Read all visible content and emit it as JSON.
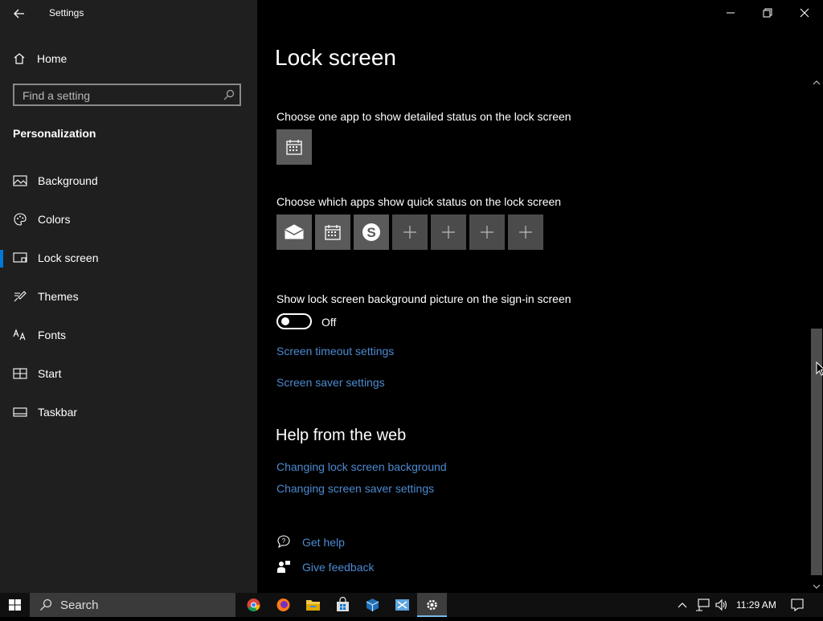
{
  "window": {
    "title": "Settings"
  },
  "sidebar": {
    "home_label": "Home",
    "search_placeholder": "Find a setting",
    "section_title": "Personalization",
    "items": [
      {
        "label": "Background",
        "icon": "picture-icon"
      },
      {
        "label": "Colors",
        "icon": "palette-icon"
      },
      {
        "label": "Lock screen",
        "icon": "lock-screen-icon",
        "active": true
      },
      {
        "label": "Themes",
        "icon": "brush-icon"
      },
      {
        "label": "Fonts",
        "icon": "font-icon"
      },
      {
        "label": "Start",
        "icon": "start-icon"
      },
      {
        "label": "Taskbar",
        "icon": "taskbar-icon"
      }
    ]
  },
  "main": {
    "title": "Lock screen",
    "detailed_status_label": "Choose one app to show detailed status on the lock screen",
    "detailed_status_app": "calendar-icon",
    "quick_status_label": "Choose which apps show quick status on the lock screen",
    "quick_status_apps": [
      "mail-icon",
      "calendar-icon",
      "skype-icon",
      "plus-icon",
      "plus-icon",
      "plus-icon",
      "plus-icon"
    ],
    "signin_bg_label": "Show lock screen background picture on the sign-in screen",
    "signin_bg_state": "Off",
    "screen_timeout_link": "Screen timeout settings",
    "screen_saver_link": "Screen saver settings",
    "help_heading": "Help from the web",
    "help_links": [
      "Changing lock screen background",
      "Changing screen saver settings"
    ],
    "get_help": "Get help",
    "give_feedback": "Give feedback"
  },
  "taskbar": {
    "search_label": "Search",
    "time": "11:29 AM",
    "apps": [
      "chrome-icon",
      "firefox-icon",
      "file-explorer-icon",
      "store-icon",
      "virtualbox-icon",
      "snipping-icon",
      "settings-icon"
    ]
  },
  "colors": {
    "accent": "#0078d7",
    "link": "#4c8ad0",
    "sidebar_bg": "#1f1f1f",
    "main_bg": "#000000"
  }
}
